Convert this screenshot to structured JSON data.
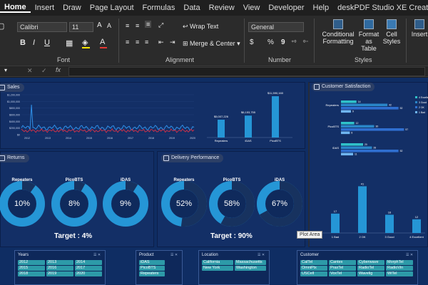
{
  "menu": [
    "Home",
    "Insert",
    "Draw",
    "Page Layout",
    "Formulas",
    "Data",
    "Review",
    "View",
    "Developer",
    "Help",
    "deskPDF Studio XE Creator"
  ],
  "ribbon": {
    "font_name": "Calibri",
    "font_size": "11",
    "number_format": "General",
    "wrap_text": "Wrap Text",
    "merge_center": "Merge & Center",
    "conditional": "Conditional",
    "formatting": "Formatting",
    "format_as": "Format as",
    "table": "Table",
    "cell": "Cell",
    "styles": "Styles",
    "insert": "Insert",
    "group_font": "Font",
    "group_alignment": "Alignment",
    "group_number": "Number",
    "group_styles": "Styles"
  },
  "colors": {
    "dash_bg": "#0f2d63",
    "accent": "#2596d6",
    "donut_dark": "#17325f",
    "chip": "#2d9aa8"
  },
  "sales": {
    "title": "Sales",
    "y_ticks": [
      "$1,200,000",
      "$1,000,000",
      "$800,000",
      "$600,000",
      "$400,000",
      "$200,000",
      "$0"
    ],
    "x_ticks": [
      "2012",
      "2013",
      "2014",
      "2015",
      "2016",
      "2017",
      "2018",
      "2019",
      "2020"
    ],
    "chart_data": {
      "type": "bar",
      "categories": [
        "Repeaters",
        "iDAS",
        "PicoBTS"
      ],
      "values": [
        5007226,
        6153755,
        11590160
      ],
      "labels": [
        "$5,007,226",
        "$6,153,755",
        "$11,590,160"
      ]
    }
  },
  "satisfaction": {
    "title": "Customer Satisfaction",
    "categories": [
      "Repeaters",
      "PicoBTS",
      "iDAS"
    ],
    "legend": [
      "4 Excellent",
      "3 Good",
      "2 OK",
      "1 Bad"
    ],
    "legend_colors": [
      "#2fc1c9",
      "#2a86c8",
      "#2f6fd0",
      "#6fb5f0"
    ],
    "hbar_values": [
      [
        14,
        42,
        52,
        9
      ],
      [
        12,
        30,
        57,
        8
      ],
      [
        20,
        28,
        52,
        11
      ]
    ],
    "chart_data": {
      "type": "bar",
      "categories": [
        "1 Bad",
        "2 OK",
        "3 Good",
        "4 Excellent"
      ],
      "values": [
        17,
        41,
        16,
        12
      ]
    }
  },
  "returns": {
    "title": "Returns",
    "items": [
      {
        "name": "Repeaters",
        "pct": "10%",
        "value": 0.1
      },
      {
        "name": "PicoBTS",
        "pct": "8%",
        "value": 0.08
      },
      {
        "name": "iDAS",
        "pct": "9%",
        "value": 0.09
      }
    ],
    "target": "Target : 4%"
  },
  "delivery": {
    "title": "Delivery Performance",
    "items": [
      {
        "name": "Repeaters",
        "pct": "52%",
        "value": 0.52
      },
      {
        "name": "PicoBTS",
        "pct": "58%",
        "value": 0.58
      },
      {
        "name": "iDAS",
        "pct": "67%",
        "value": 0.67
      }
    ],
    "target": "Target : 90%"
  },
  "tooltip": "Plot Area",
  "slicers": {
    "years": {
      "title": "Years",
      "items": [
        "2012",
        "2013",
        "2014",
        "2015",
        "2016",
        "2017",
        "2018",
        "2019",
        "2020"
      ]
    },
    "product": {
      "title": "Product",
      "items": [
        "iDAS",
        "PicoBTS",
        "Repeaters"
      ]
    },
    "location": {
      "title": "Location",
      "items": [
        "California",
        "Massachusetts",
        "New York",
        "Washington"
      ]
    },
    "customer": {
      "title": "Customer",
      "items": [
        "CalTel",
        "Cantex",
        "Cyberwave",
        "MorphTel",
        "OmniPix",
        "PraxTel",
        "RadioTel",
        "RadioVin",
        "USCell",
        "VoxTel",
        "Wavelig",
        "WiTel"
      ]
    }
  }
}
